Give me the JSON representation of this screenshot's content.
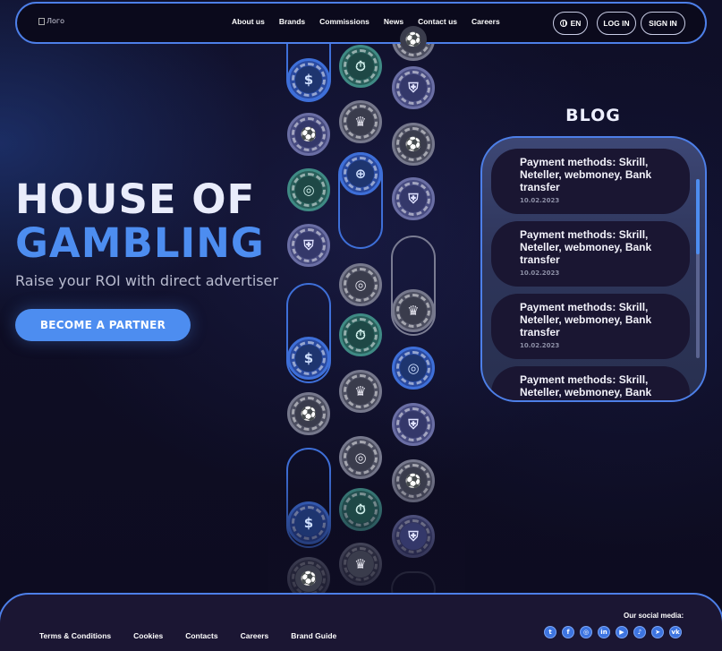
{
  "header": {
    "logo_alt": "Лого",
    "nav": [
      "About us",
      "Brands",
      "Commissions",
      "News",
      "Contact us",
      "Careers"
    ],
    "lang": "EN",
    "login": "LOG IN",
    "signin": "SIGN IN"
  },
  "hero": {
    "title_line1": "HOUSE OF",
    "title_line2": "GAMBLING",
    "subtitle": "Raise your ROI with direct advertiser",
    "cta": "BECOME A PARTNER"
  },
  "blog": {
    "title": "BLOG",
    "posts": [
      {
        "title": "Payment methods: Skrill, Neteller, webmoney, Bank transfer",
        "date": "10.02.2023"
      },
      {
        "title": "Payment methods: Skrill, Neteller, webmoney, Bank transfer",
        "date": "10.02.2023"
      },
      {
        "title": "Payment methods: Skrill, Neteller, webmoney, Bank transfer",
        "date": "10.02.2023"
      },
      {
        "title": "Payment methods: Skrill, Neteller, webmoney, Bank",
        "date": ""
      }
    ]
  },
  "footer": {
    "links": [
      "Terms & Conditions",
      "Cookies",
      "Contacts",
      "Careers",
      "Brand Guide"
    ],
    "social_label": "Our social media:",
    "socials": [
      "twitter-icon",
      "facebook-icon",
      "instagram-icon",
      "linkedin-icon",
      "youtube-icon",
      "tiktok-icon",
      "telegram-icon",
      "vk-icon"
    ]
  },
  "colors": {
    "accent": "#4d8df0",
    "border": "#4d7fe8",
    "background": "#0e0d22"
  }
}
